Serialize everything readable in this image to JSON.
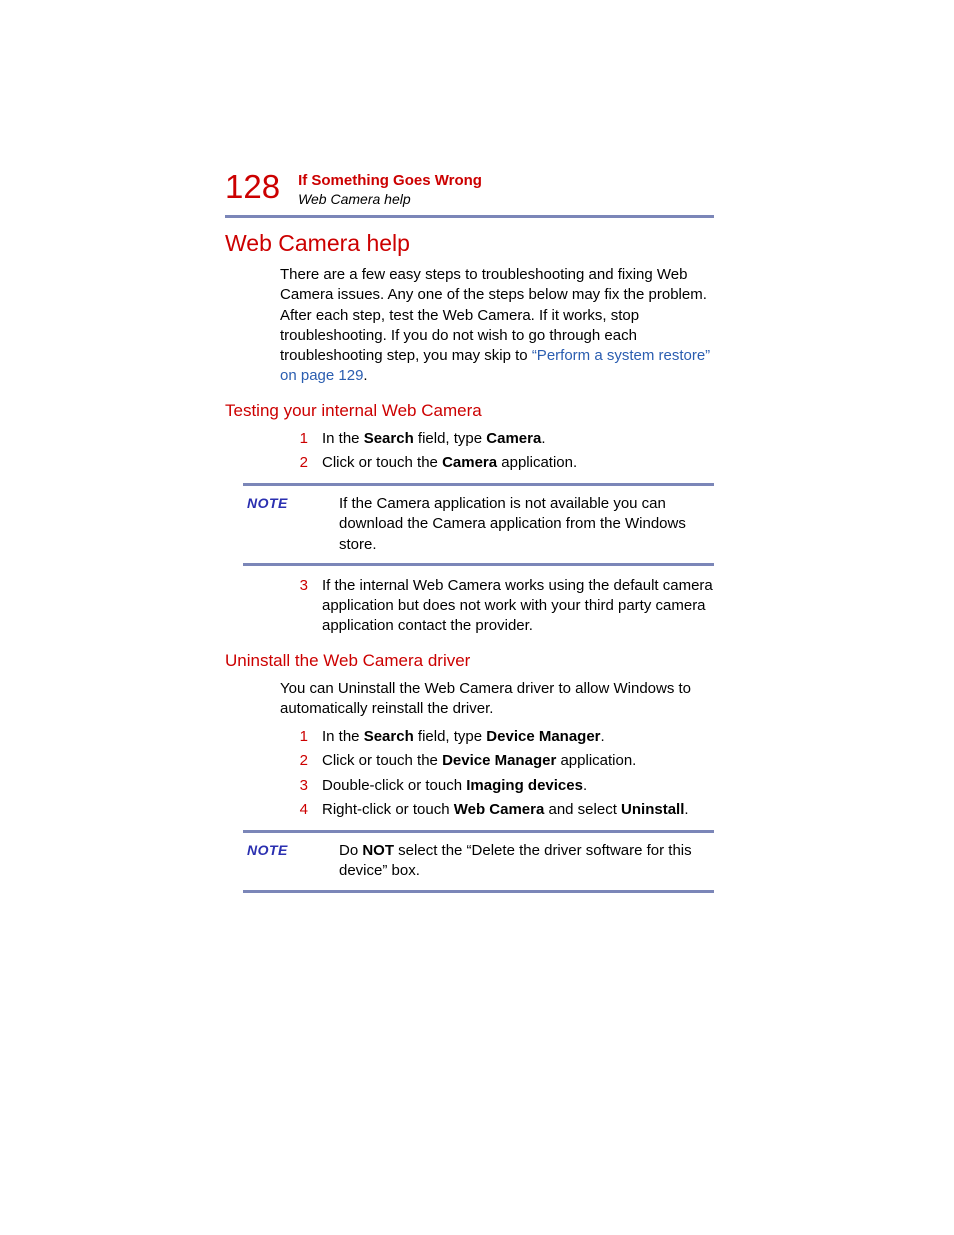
{
  "header": {
    "page_number": "128",
    "chapter_title": "If Something Goes Wrong",
    "section_title": "Web Camera help"
  },
  "h1": "Web Camera help",
  "intro": {
    "text_before_link": "There are a few easy steps to troubleshooting and fixing Web Camera issues. Any one of the steps below may fix the problem. After each step, test the Web Camera. If it works, stop troubleshooting. If you do not wish to go through each troubleshooting step, you may skip to ",
    "link_text": "“Perform a system restore” on page 129",
    "text_after_link": "."
  },
  "testing": {
    "heading": "Testing your internal Web Camera",
    "steps": {
      "s1_num": "1",
      "s1_pre": "In the ",
      "s1_b1": "Search",
      "s1_mid": " field, type ",
      "s1_b2": "Camera",
      "s1_post": ".",
      "s2_num": "2",
      "s2_pre": "Click or touch the ",
      "s2_b1": "Camera",
      "s2_post": " application.",
      "s3_num": "3",
      "s3_text": "If the internal Web Camera works using the default camera application but does not work with your third party camera application contact the provider."
    },
    "note": {
      "label": "NOTE",
      "text": "If the Camera application is not available you can download the Camera application from the Windows store."
    }
  },
  "uninstall": {
    "heading": "Uninstall the Web Camera driver",
    "intro": "You can Uninstall the Web Camera driver to allow Windows to automatically reinstall the driver.",
    "steps": {
      "s1_num": "1",
      "s1_pre": "In the ",
      "s1_b1": "Search",
      "s1_mid": " field, type ",
      "s1_b2": "Device Manager",
      "s1_post": ".",
      "s2_num": "2",
      "s2_pre": "Click or touch the ",
      "s2_b1": "Device Manager",
      "s2_post": " application.",
      "s3_num": "3",
      "s3_pre": "Double-click or touch ",
      "s3_b1": "Imaging devices",
      "s3_post": ".",
      "s4_num": "4",
      "s4_pre": "Right-click or touch ",
      "s4_b1": "Web Camera",
      "s4_mid": " and select ",
      "s4_b2": "Uninstall",
      "s4_post": "."
    },
    "note": {
      "label": "NOTE",
      "text_pre": "Do ",
      "text_bold": "NOT",
      "text_post": " select the “Delete the driver software for this device” box."
    }
  }
}
